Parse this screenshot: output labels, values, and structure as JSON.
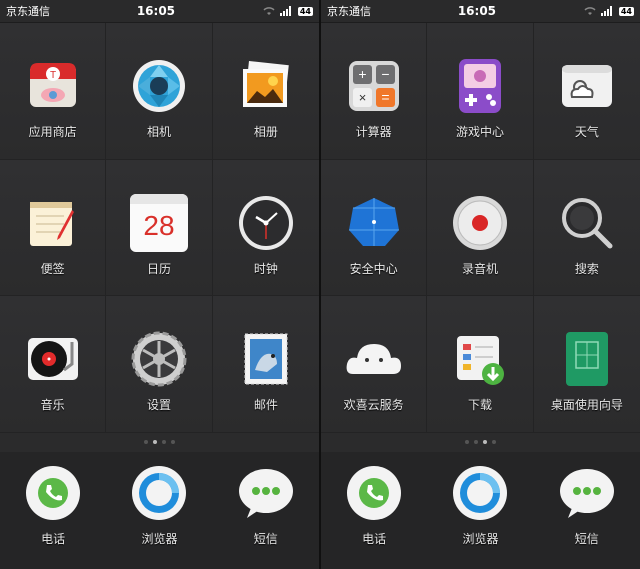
{
  "screens": [
    {
      "status": {
        "carrier": "京东通信",
        "time": "16:05",
        "battery": "44"
      },
      "apps": [
        {
          "label": "应用商店",
          "icon": "app-store-icon"
        },
        {
          "label": "相机",
          "icon": "camera-icon"
        },
        {
          "label": "相册",
          "icon": "photo-album-icon"
        },
        {
          "label": "便签",
          "icon": "notes-icon"
        },
        {
          "label": "日历",
          "icon": "calendar-icon",
          "badge": "28"
        },
        {
          "label": "时钟",
          "icon": "clock-icon"
        },
        {
          "label": "音乐",
          "icon": "music-icon"
        },
        {
          "label": "设置",
          "icon": "settings-gear-icon"
        },
        {
          "label": "邮件",
          "icon": "mail-icon"
        }
      ],
      "dock": [
        {
          "label": "电话",
          "icon": "phone-icon"
        },
        {
          "label": "浏览器",
          "icon": "browser-icon"
        },
        {
          "label": "短信",
          "icon": "sms-icon"
        }
      ]
    },
    {
      "status": {
        "carrier": "京东通信",
        "time": "16:05",
        "battery": "44"
      },
      "apps": [
        {
          "label": "计算器",
          "icon": "calculator-icon"
        },
        {
          "label": "游戏中心",
          "icon": "game-center-icon"
        },
        {
          "label": "天气",
          "icon": "weather-icon"
        },
        {
          "label": "安全中心",
          "icon": "security-umbrella-icon"
        },
        {
          "label": "录音机",
          "icon": "recorder-icon"
        },
        {
          "label": "搜索",
          "icon": "search-icon"
        },
        {
          "label": "欢喜云服务",
          "icon": "cloud-service-icon"
        },
        {
          "label": "下载",
          "icon": "download-icon"
        },
        {
          "label": "桌面使用向导",
          "icon": "guide-book-icon"
        }
      ],
      "dock": [
        {
          "label": "电话",
          "icon": "phone-icon"
        },
        {
          "label": "浏览器",
          "icon": "browser-icon"
        },
        {
          "label": "短信",
          "icon": "sms-icon"
        }
      ]
    }
  ]
}
